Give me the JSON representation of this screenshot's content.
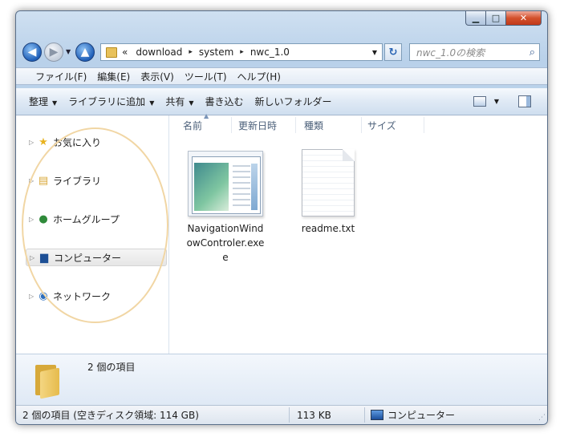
{
  "window": {
    "caption_buttons": {
      "minimize": "▁",
      "maximize": "□",
      "close": "✕"
    }
  },
  "navigation": {
    "back_glyph": "◀",
    "forward_glyph": "▶",
    "up_glyph": "▲",
    "history_glyph": "▼"
  },
  "address": {
    "overflow": "«",
    "separator": "▸",
    "crumbs": [
      "download",
      "system",
      "nwc_1.0"
    ],
    "dropdown_glyph": "▼",
    "refresh_glyph": "↻"
  },
  "search": {
    "placeholder": "nwc_1.0の検索",
    "icon_glyph": "⌕"
  },
  "menu": {
    "items": [
      "ファイル(F)",
      "編集(E)",
      "表示(V)",
      "ツール(T)",
      "ヘルプ(H)"
    ]
  },
  "command_bar": {
    "organize": "整理",
    "add_to_library": "ライブラリに追加",
    "share": "共有",
    "burn": "書き込む",
    "new_folder": "新しいフォルダー",
    "dropdown_glyph": "▼"
  },
  "nav_pane": {
    "expand_glyph": "▷",
    "items": [
      {
        "label": "お気に入り",
        "icon": "star-icon",
        "glyph": "★"
      },
      {
        "label": "ライブラリ",
        "icon": "library-icon",
        "glyph": "▤"
      },
      {
        "label": "ホームグループ",
        "icon": "homegroup-icon",
        "glyph": "●"
      },
      {
        "label": "コンピューター",
        "icon": "computer-icon",
        "glyph": "▆"
      },
      {
        "label": "ネットワーク",
        "icon": "network-icon",
        "glyph": "◉"
      }
    ]
  },
  "columns": [
    "名前",
    "更新日時",
    "種類",
    "サイズ"
  ],
  "sort_caret": "▲",
  "files": [
    {
      "name_line1": "NavigationWind",
      "name_line2": "owControler.exe",
      "name_line3": "e",
      "icon": "exe-thumbnail-icon"
    },
    {
      "name_line1": "readme.txt",
      "icon": "text-file-icon"
    }
  ],
  "details": {
    "summary": "2 個の項目"
  },
  "status": {
    "items_free": "2 個の項目 (空きディスク領域: 114 GB)",
    "size": "113 KB",
    "location": "コンピューター",
    "grip": "⋰"
  },
  "colors": {
    "frame": "#b9d1ea",
    "highlight_ellipse": "#f1d6a4",
    "accent_blue": "#1f5fb8"
  }
}
